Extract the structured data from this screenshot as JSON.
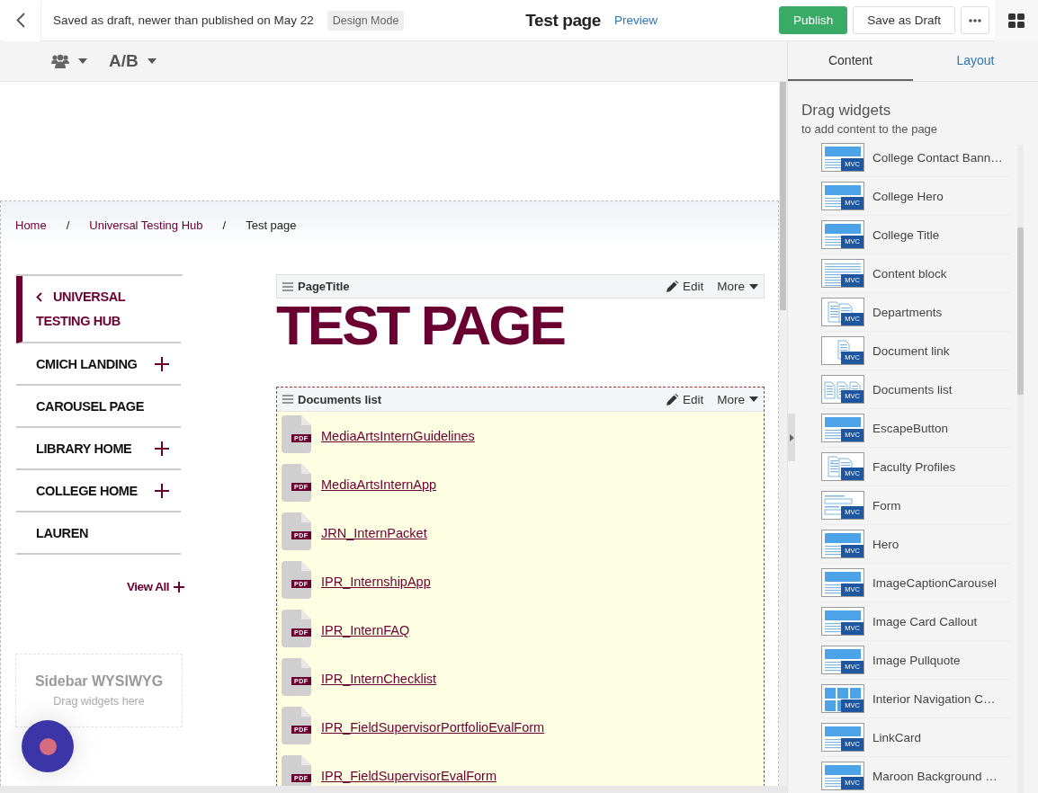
{
  "header": {
    "status": "Saved as draft, newer than published on May 22",
    "mode_badge": "Design Mode",
    "page_title": "Test page",
    "preview_link": "Preview",
    "buttons": [
      {
        "label": "Publish",
        "kind": "primary"
      },
      {
        "label": "Save as Draft",
        "kind": "secondary"
      }
    ]
  },
  "toolbar": {
    "ab_label": "A/B"
  },
  "breadcrumb": {
    "items": [
      {
        "label": "Home",
        "link": true
      },
      {
        "label": "Universal Testing Hub",
        "link": true
      },
      {
        "label": "Test page",
        "link": false
      }
    ],
    "separators": [
      "/",
      "/"
    ]
  },
  "sidebar_nav": {
    "items": [
      {
        "label": "UNIVERSAL TESTING HUB",
        "kind": "parent"
      },
      {
        "label": "CMICH LANDING",
        "kind": "page",
        "expandable": true
      },
      {
        "label": "CAROUSEL PAGE",
        "kind": "page",
        "expandable": false
      },
      {
        "label": "LIBRARY HOME",
        "kind": "page",
        "expandable": true
      },
      {
        "label": "COLLEGE HOME",
        "kind": "page",
        "expandable": true
      },
      {
        "label": "LAUREN",
        "kind": "page",
        "expandable": false
      }
    ],
    "view_all": "View All"
  },
  "sidebar_widget": {
    "title": "Sidebar WYSIWYG",
    "hint": "Drag widgets here"
  },
  "widgets": [
    {
      "name": "PageTitle",
      "kind": "title",
      "selected": false,
      "edit": "Edit",
      "more": "More",
      "heading": "TEST PAGE"
    },
    {
      "name": "Documents list",
      "kind": "documents",
      "selected": true,
      "edit": "Edit",
      "more": "More",
      "documents": [
        {
          "label": "MediaArtsInternGuidelines",
          "badge": "PDF"
        },
        {
          "label": "MediaArtsInternApp",
          "badge": "PDF"
        },
        {
          "label": "JRN_InternPacket",
          "badge": "PDF"
        },
        {
          "label": "IPR_InternshipApp",
          "badge": "PDF"
        },
        {
          "label": "IPR_InternFAQ",
          "badge": "PDF"
        },
        {
          "label": "IPR_InternChecklist",
          "badge": "PDF"
        },
        {
          "label": "IPR_FieldSupervisorPortfolioEvalForm",
          "badge": "PDF"
        },
        {
          "label": "IPR_FieldSupervisorEvalForm",
          "badge": "PDF"
        }
      ]
    }
  ],
  "right_panel": {
    "tabs": [
      {
        "label": "Content",
        "selected": true
      },
      {
        "label": "Layout",
        "selected": false
      }
    ],
    "title": "Drag widgets",
    "subtitle": "to add content to the page",
    "widgets": [
      {
        "label": "College Contact Bann…",
        "kind": "banner",
        "badge": "MVC"
      },
      {
        "label": "College Hero",
        "kind": "banner",
        "badge": "MVC"
      },
      {
        "label": "College Title",
        "kind": "banner",
        "badge": "MVC"
      },
      {
        "label": "Content block",
        "kind": "text",
        "badge": "MVC"
      },
      {
        "label": "Departments",
        "kind": "list",
        "badge": "MVC"
      },
      {
        "label": "Document link",
        "kind": "doc",
        "badge": "MVC"
      },
      {
        "label": "Documents list",
        "kind": "docs",
        "badge": "MVC"
      },
      {
        "label": "EscapeButton",
        "kind": "banner",
        "badge": "MVC"
      },
      {
        "label": "Faculty Profiles",
        "kind": "list",
        "badge": "MVC"
      },
      {
        "label": "Form",
        "kind": "form",
        "badge": "MVC"
      },
      {
        "label": "Hero",
        "kind": "banner",
        "badge": "MVC"
      },
      {
        "label": "ImageCaptionCarousel",
        "kind": "banner",
        "badge": "MVC"
      },
      {
        "label": "Image Card Callout",
        "kind": "banner",
        "badge": "MVC"
      },
      {
        "label": "Image Pullquote",
        "kind": "banner",
        "badge": "MVC"
      },
      {
        "label": "Interior Navigation C…",
        "kind": "grid",
        "badge": "MVC"
      },
      {
        "label": "LinkCard",
        "kind": "banner",
        "badge": "MVC"
      },
      {
        "label": "Maroon Background …",
        "kind": "banner",
        "badge": "MVC"
      }
    ]
  }
}
